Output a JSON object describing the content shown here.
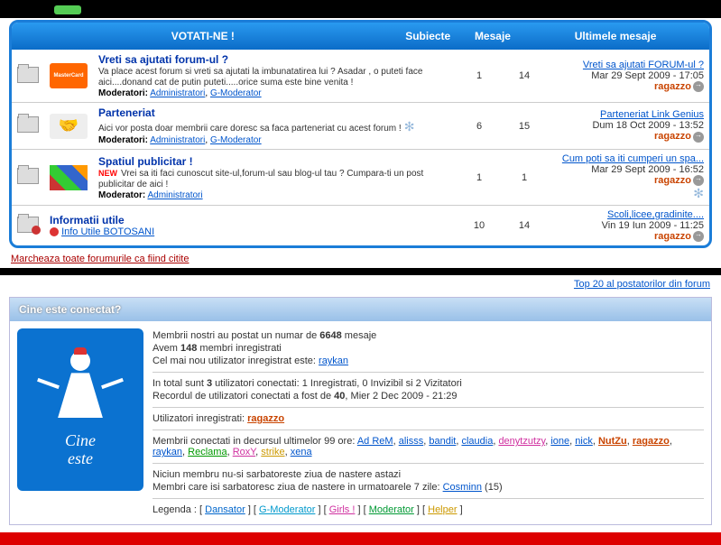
{
  "header": {
    "votati": "VOTATI-NE !",
    "subiecte": "Subiecte",
    "mesaje": "Mesaje",
    "ultimele": "Ultimele mesaje"
  },
  "forums": [
    {
      "title": "Vreti sa ajutati forum-ul ?",
      "desc": "Va place acest forum si vreti sa ajutati la imbunatatirea lui ? Asadar , o puteti face aici....donand cat de putin puteti.....orice suma este bine venita !",
      "mods_label": "Moderatori:",
      "mods": [
        "Administratori",
        "G-Moderator"
      ],
      "subj": "1",
      "msg": "14",
      "last_link": "Vreti sa ajutati FORUM-ul ?",
      "last_date": "Mar 29 Sept 2009 - 17:05",
      "last_author": "ragazzo",
      "img": "mc",
      "new": false
    },
    {
      "title": "Parteneriat",
      "desc": "Aici vor posta doar membrii care doresc sa faca parteneriat cu acest forum !",
      "mods_label": "Moderatori:",
      "mods": [
        "Administratori",
        "G-Moderator"
      ],
      "subj": "6",
      "msg": "15",
      "last_link": "Parteneriat Link Genius",
      "last_date": "Dum 18 Oct 2009 - 13:52",
      "last_author": "ragazzo",
      "img": "hs",
      "new": false
    },
    {
      "title": "Spatiul publicitar !",
      "desc": "Vrei sa iti faci cunoscut site-ul,forum-ul sau blog-ul tau ? Cumpara-ti un post publicitar de aici !",
      "mods_label": "Moderator:",
      "mods": [
        "Administratori"
      ],
      "subj": "1",
      "msg": "1",
      "last_link": "Cum poti sa iti cumperi un spa...",
      "last_date": "Mar 29 Sept 2009 - 16:52",
      "last_author": "ragazzo",
      "img": "chart",
      "new": true
    },
    {
      "title": "Informatii utile",
      "sub_link": "Info Utile BOTOSANI",
      "subj": "10",
      "msg": "14",
      "last_link": "Scoli,licee,gradinite....",
      "last_date": "Vin 19 Iun 2009 - 11:25",
      "last_author": "ragazzo",
      "img": "none",
      "lock": true
    }
  ],
  "badges": {
    "new": "NEW",
    "mc": "MasterCard",
    "hs": "🤝"
  },
  "mark_read": "Marcheaza toate forumurile ca fiind citite",
  "top_posters": "Top 20 al postatorilor din forum",
  "who_online": {
    "title": "Cine este conectat?",
    "avatar": {
      "line1": "Cine",
      "line2": "este"
    },
    "line1a": "Membrii nostri au postat un numar de ",
    "line1b": "6648",
    "line1c": " mesaje",
    "line2a": "Avem ",
    "line2b": "148",
    "line2c": " membri inregistrati",
    "line3a": "Cel mai nou utilizator inregistrat este: ",
    "line3b": "raykan",
    "line4a": "In total sunt ",
    "line4b": "3",
    "line4c": " utilizatori conectati: 1 Inregistrati, 0 Invizibil si 2 Vizitatori",
    "line5a": "Recordul de utilizatori conectati a fost de ",
    "line5b": "40",
    "line5c": ", Mier 2 Dec 2009 - 21:29",
    "line6": "Utilizatori inregistrati: ",
    "line6u": "ragazzo",
    "line7": "Membrii conectati in decursul ultimelor 99 ore: ",
    "recent": [
      "Ad ReM",
      "alisss",
      "bandit",
      "claudia",
      "denytzutzy",
      "ione",
      "nick",
      "NutZu",
      "ragazzo",
      "raykan",
      "Reclama",
      "RoxY",
      "strike",
      "xena"
    ],
    "line8": "Niciun membru nu-si sarbatoreste ziua de nastere astazi",
    "line9a": "Membri care isi sarbatoresc ziua de nastere in urmatoarele 7 zile: ",
    "line9b": "Cosminn",
    "line9c": " (15)",
    "legend_label": "Legenda :  ",
    "legend": {
      "d": "Dansator",
      "g": "G-Moderator",
      "gi": "Girls !",
      "m": "Moderator",
      "h": "Helper"
    }
  }
}
